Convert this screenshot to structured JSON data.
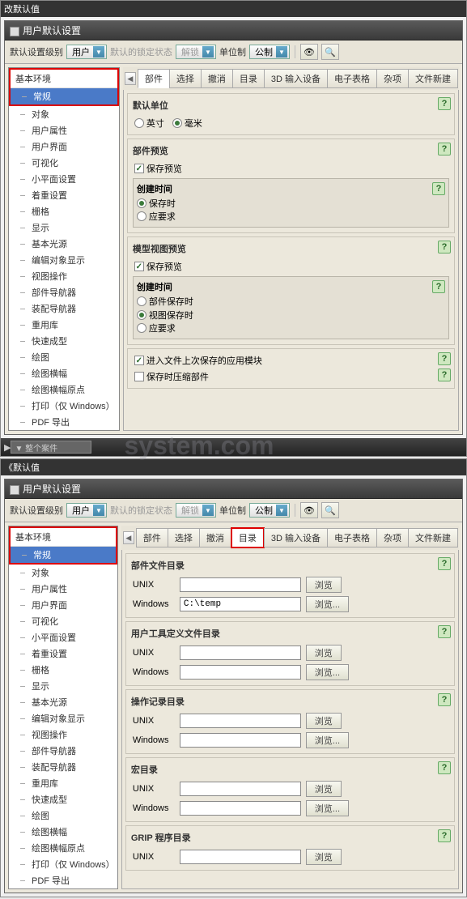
{
  "top_outer_title": "改默认值",
  "bot_outer_title": "《默认值",
  "dialog_title": "用户默认设置",
  "toolbar": {
    "level_label": "默认设置级别",
    "level_value": "用户",
    "lock_label": "默认的锁定状态",
    "lock_value": "解锁",
    "unit_label": "单位制",
    "unit_value": "公制"
  },
  "tree": {
    "head": "基本环境",
    "sel": "常规",
    "items": [
      "对象",
      "用户属性",
      "用户界面",
      "可视化",
      "小平面设置",
      "着重设置",
      "栅格",
      "显示",
      "基本光源",
      "编辑对象显示",
      "视图操作",
      "部件导航器",
      "装配导航器",
      "重用库",
      "快速成型",
      "绘图",
      "绘图横幅",
      "绘图横幅原点",
      "打印（仅 Windows）",
      "PDF 导出"
    ]
  },
  "tabs": [
    "部件",
    "选择",
    "撤消",
    "目录",
    "3D 输入设备",
    "电子表格",
    "杂项",
    "文件新建"
  ],
  "panel1": {
    "g1_title": "默认单位",
    "inch": "英寸",
    "mm": "毫米",
    "g2_title": "部件预览",
    "save_preview": "保存预览",
    "create_time": "创建时间",
    "on_save": "保存时",
    "on_demand": "应要求",
    "g3_title": "模型视图预览",
    "on_part_save": "部件保存时",
    "on_view_save": "视图保存时",
    "enter_last": "进入文件上次保存的应用模块",
    "compress": "保存时压缩部件"
  },
  "panel2": {
    "g1": "部件文件目录",
    "g2": "用户工具定义文件目录",
    "g3": "操作记录目录",
    "g4": "宏目录",
    "g5": "GRIP 程序目录",
    "unix": "UNIX",
    "windows": "Windows",
    "win_path": "C:\\temp",
    "browse": "浏览",
    "browse2": "浏览..."
  },
  "watermark": "system.com",
  "bot_combo": "▼ 整个案件"
}
